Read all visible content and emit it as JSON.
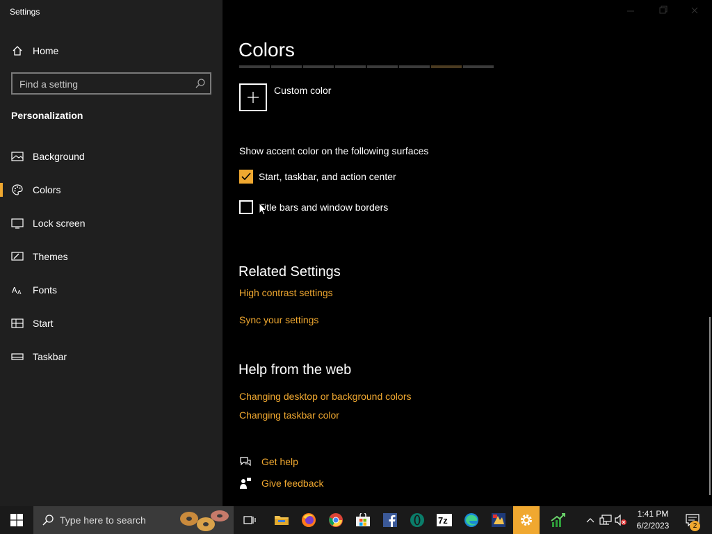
{
  "window": {
    "title": "Settings",
    "minimize_icon": "minimize-icon",
    "maximize_icon": "maximize-icon",
    "close_icon": "close-icon"
  },
  "sidebar": {
    "home_label": "Home",
    "home_icon": "home-icon",
    "search": {
      "placeholder": "Find a setting",
      "icon": "search-icon"
    },
    "section_heading": "Personalization",
    "items": [
      {
        "label": "Background",
        "icon": "picture-icon",
        "active": false
      },
      {
        "label": "Colors",
        "icon": "palette-icon",
        "active": true
      },
      {
        "label": "Lock screen",
        "icon": "lock-screen-icon",
        "active": false
      },
      {
        "label": "Themes",
        "icon": "brush-icon",
        "active": false
      },
      {
        "label": "Fonts",
        "icon": "font-icon",
        "active": false
      },
      {
        "label": "Start",
        "icon": "start-icon",
        "active": false
      },
      {
        "label": "Taskbar",
        "icon": "taskbar-icon",
        "active": false
      }
    ]
  },
  "main": {
    "title": "Colors",
    "custom_color_label": "Custom color",
    "surfaces_heading": "Show accent color on the following surfaces",
    "checkboxes": [
      {
        "label": "Start, taskbar, and action center",
        "checked": true
      },
      {
        "label": "Title bars and window borders",
        "checked": false
      }
    ],
    "related_heading": "Related Settings",
    "related_links": [
      "High contrast settings",
      "Sync your settings"
    ],
    "help_heading": "Help from the web",
    "help_links": [
      "Changing desktop or background colors",
      "Changing taskbar color"
    ],
    "get_help": "Get help",
    "give_feedback": "Give feedback"
  },
  "taskbar": {
    "search_placeholder": "Type here to search",
    "apps": [
      {
        "name": "task-view-icon"
      },
      {
        "name": "file-explorer-icon"
      },
      {
        "name": "firefox-icon"
      },
      {
        "name": "chrome-icon"
      },
      {
        "name": "microsoft-store-icon"
      },
      {
        "name": "facebook-icon"
      },
      {
        "name": "opera-icon"
      },
      {
        "name": "7zip-icon"
      },
      {
        "name": "edge-icon"
      },
      {
        "name": "app-icon"
      },
      {
        "name": "settings-icon"
      },
      {
        "name": "stock-chart-icon"
      }
    ],
    "time": "1:41 PM",
    "date": "6/2/2023",
    "notification_count": "2"
  },
  "colors": {
    "accent": "#f0a830",
    "sidebar_bg": "#1f1f1f",
    "main_bg": "#000000",
    "taskbar_bg": "#1a1a1a"
  }
}
